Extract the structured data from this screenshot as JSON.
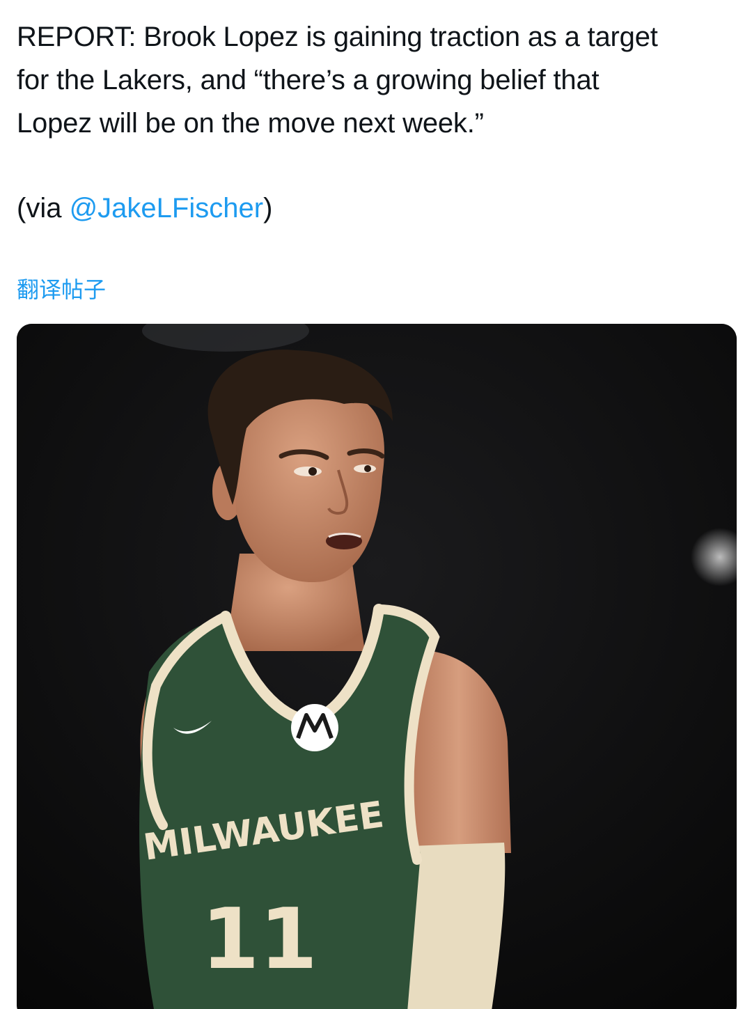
{
  "tweet": {
    "lines": [
      "REPORT: Brook Lopez is gaining traction as a target",
      "for the Lakers, and “there’s a growing belief that",
      "Lopez will be on the move next week.”"
    ],
    "via_prefix": "(via ",
    "mention": "@JakeLFischer",
    "via_suffix": ")",
    "translate_label": "翻译帖子"
  },
  "media": {
    "description": "Photo of basketball player in green Milwaukee jersey",
    "jersey_text": "MILWAUKEE",
    "jersey_number": "11"
  },
  "colors": {
    "link": "#1d9bf0",
    "text": "#0f1419",
    "jersey_green": "#2f5138",
    "jersey_trim": "#eee1c6"
  }
}
